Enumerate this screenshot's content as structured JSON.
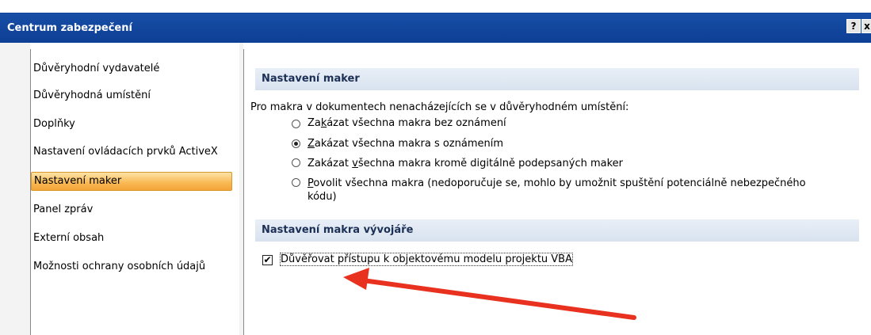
{
  "window": {
    "title": "Centrum zabezpečení",
    "help_button": "?",
    "close_button": "x"
  },
  "sidebar": {
    "items": [
      {
        "label": "Důvěryhodní vydavatelé"
      },
      {
        "label": "Důvěryhodná umístění"
      },
      {
        "label": "Doplňky"
      },
      {
        "label": "Nastavení ovládacích prvků ActiveX"
      },
      {
        "label": "Nastavení maker",
        "selected": true
      },
      {
        "label": "Panel zpráv"
      },
      {
        "label": "Externí obsah"
      },
      {
        "label": "Možnosti ochrany osobních údajů"
      }
    ]
  },
  "main": {
    "macro_section": {
      "header": "Nastavení maker",
      "intro": "Pro makra v dokumentech nenacházejících se v důvěryhodném umístění:",
      "options": [
        {
          "pre": "Za",
          "ul": "k",
          "post": "ázat všechna makra bez oznámení",
          "checked": false
        },
        {
          "pre": "",
          "ul": "Z",
          "post": "akázat všechna makra s oznámením",
          "checked": true
        },
        {
          "pre": "Zakázat ",
          "ul": "v",
          "post": "šechna makra kromě digitálně podepsaných maker",
          "checked": false
        },
        {
          "pre": "",
          "ul": "P",
          "post": "ovolit všechna makra (nedoporučuje se, mohlo by umožnit spuštění potenciálně nebezpečného",
          "line2": "kódu)",
          "checked": false
        }
      ]
    },
    "dev_section": {
      "header": "Nastavení makra vývojáře",
      "checkbox_label": "Důvěřovat přístupu k objektovému modelu projektu VBA",
      "checkbox_checked": true,
      "checkbox_mark": "✔"
    }
  },
  "annotation": {
    "arrow_color": "#e8321f"
  }
}
